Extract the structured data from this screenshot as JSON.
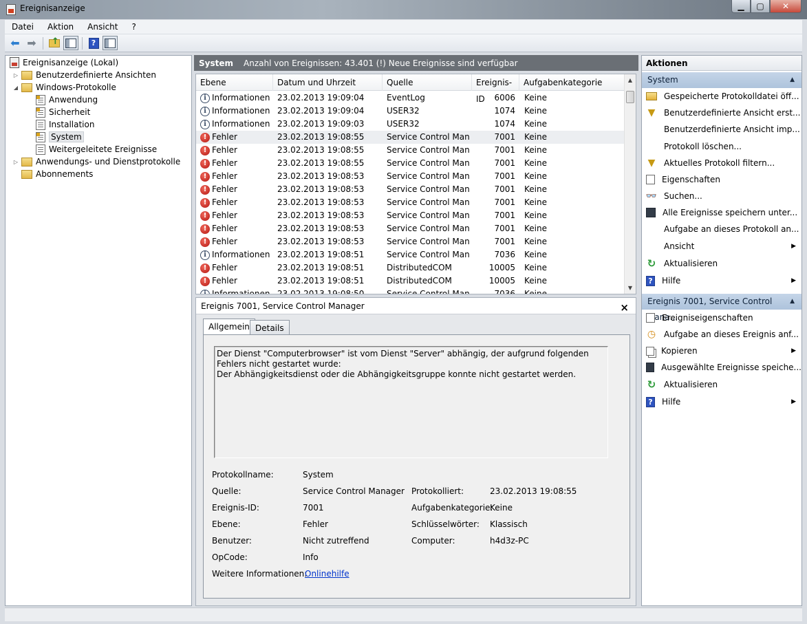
{
  "window": {
    "title": "Ereignisanzeige",
    "buttons": {
      "minimize": "▁",
      "maximize": "▢",
      "close": "✕"
    }
  },
  "menu": [
    "Datei",
    "Aktion",
    "Ansicht",
    "?"
  ],
  "tree": {
    "root": "Ereignisanzeige (Lokal)",
    "custom_views": "Benutzerdefinierte Ansichten",
    "windows_logs": "Windows-Protokolle",
    "application": "Anwendung",
    "security": "Sicherheit",
    "setup": "Installation",
    "system": "System",
    "forwarded": "Weitergeleitete Ereignisse",
    "app_service_logs": "Anwendungs- und Dienstprotokolle",
    "subscriptions": "Abonnements"
  },
  "center": {
    "title": "System",
    "info": "Anzahl von Ereignissen: 43.401 (!) Neue Ereignisse sind verfügbar"
  },
  "grid": {
    "columns": {
      "level": "Ebene",
      "date": "Datum und Uhrzeit",
      "source": "Quelle",
      "event_id": "Ereignis-ID",
      "category": "Aufgabenkategorie"
    },
    "rows": [
      {
        "type": "info",
        "level": "Informationen",
        "date": "23.02.2013 19:09:04",
        "source": "EventLog",
        "event_id": "6006",
        "category": "Keine"
      },
      {
        "type": "info",
        "level": "Informationen",
        "date": "23.02.2013 19:09:04",
        "source": "USER32",
        "event_id": "1074",
        "category": "Keine"
      },
      {
        "type": "info",
        "level": "Informationen",
        "date": "23.02.2013 19:09:03",
        "source": "USER32",
        "event_id": "1074",
        "category": "Keine"
      },
      {
        "type": "error",
        "level": "Fehler",
        "date": "23.02.2013 19:08:55",
        "source": "Service Control Man...",
        "event_id": "7001",
        "category": "Keine",
        "selected": true
      },
      {
        "type": "error",
        "level": "Fehler",
        "date": "23.02.2013 19:08:55",
        "source": "Service Control Man...",
        "event_id": "7001",
        "category": "Keine"
      },
      {
        "type": "error",
        "level": "Fehler",
        "date": "23.02.2013 19:08:55",
        "source": "Service Control Man...",
        "event_id": "7001",
        "category": "Keine"
      },
      {
        "type": "error",
        "level": "Fehler",
        "date": "23.02.2013 19:08:53",
        "source": "Service Control Man...",
        "event_id": "7001",
        "category": "Keine"
      },
      {
        "type": "error",
        "level": "Fehler",
        "date": "23.02.2013 19:08:53",
        "source": "Service Control Man...",
        "event_id": "7001",
        "category": "Keine"
      },
      {
        "type": "error",
        "level": "Fehler",
        "date": "23.02.2013 19:08:53",
        "source": "Service Control Man...",
        "event_id": "7001",
        "category": "Keine"
      },
      {
        "type": "error",
        "level": "Fehler",
        "date": "23.02.2013 19:08:53",
        "source": "Service Control Man...",
        "event_id": "7001",
        "category": "Keine"
      },
      {
        "type": "error",
        "level": "Fehler",
        "date": "23.02.2013 19:08:53",
        "source": "Service Control Man...",
        "event_id": "7001",
        "category": "Keine"
      },
      {
        "type": "error",
        "level": "Fehler",
        "date": "23.02.2013 19:08:53",
        "source": "Service Control Man...",
        "event_id": "7001",
        "category": "Keine"
      },
      {
        "type": "info",
        "level": "Informationen",
        "date": "23.02.2013 19:08:51",
        "source": "Service Control Man...",
        "event_id": "7036",
        "category": "Keine"
      },
      {
        "type": "error",
        "level": "Fehler",
        "date": "23.02.2013 19:08:51",
        "source": "DistributedCOM",
        "event_id": "10005",
        "category": "Keine"
      },
      {
        "type": "error",
        "level": "Fehler",
        "date": "23.02.2013 19:08:51",
        "source": "DistributedCOM",
        "event_id": "10005",
        "category": "Keine"
      },
      {
        "type": "info",
        "level": "Informationen",
        "date": "23.02.2013 19:08:50",
        "source": "Service Control Man...",
        "event_id": "7036",
        "category": "Keine"
      }
    ]
  },
  "detail": {
    "title": "Ereignis 7001, Service Control Manager",
    "tabs": {
      "general": "Allgemein",
      "details": "Details"
    },
    "message": "Der Dienst \"Computerbrowser\" ist vom Dienst \"Server\" abhängig, der aufgrund folgenden Fehlers nicht gestartet wurde: \nDer Abhängigkeitsdienst oder die Abhängigkeitsgruppe konnte nicht gestartet werden.",
    "labels": {
      "log_name": "Protokollname:",
      "source": "Quelle:",
      "event_id": "Ereignis-ID:",
      "level": "Ebene:",
      "user": "Benutzer:",
      "opcode": "OpCode:",
      "more_info": "Weitere Informationen:",
      "logged": "Protokolliert:",
      "task_category": "Aufgabenkategorie:",
      "keywords": "Schlüsselwörter:",
      "computer": "Computer:"
    },
    "values": {
      "log_name": "System",
      "source": "Service Control Manager",
      "event_id": "7001",
      "level": "Fehler",
      "user": "Nicht zutreffend",
      "opcode": "Info",
      "more_info_link": "Onlinehilfe",
      "logged": "23.02.2013 19:08:55",
      "task_category": "Keine",
      "keywords": "Klassisch",
      "computer": "h4d3z-PC"
    }
  },
  "actions": {
    "header": "Aktionen",
    "section1": "System",
    "items1": [
      {
        "label": "Gespeicherte Protokolldatei öff...",
        "icon": "open-folder-icon"
      },
      {
        "label": "Benutzerdefinierte Ansicht erst...",
        "icon": "filter-icon"
      },
      {
        "label": "Benutzerdefinierte Ansicht imp...",
        "icon": ""
      },
      {
        "label": "Protokoll löschen...",
        "icon": ""
      },
      {
        "label": "Aktuelles Protokoll filtern...",
        "icon": "filter-icon"
      },
      {
        "label": "Eigenschaften",
        "icon": "properties-icon"
      },
      {
        "label": "Suchen...",
        "icon": "binoculars-icon"
      },
      {
        "label": "Alle Ereignisse speichern unter...",
        "icon": "save-icon"
      },
      {
        "label": "Aufgabe an dieses Protokoll an...",
        "icon": ""
      },
      {
        "label": "Ansicht",
        "icon": "",
        "submenu": true
      },
      {
        "label": "Aktualisieren",
        "icon": "refresh-icon"
      },
      {
        "label": "Hilfe",
        "icon": "help-icon",
        "submenu": true
      }
    ],
    "section2": "Ereignis 7001, Service Control Mana...",
    "items2": [
      {
        "label": "Ereigniseigenschaften",
        "icon": "properties-icon"
      },
      {
        "label": "Aufgabe an dieses Ereignis anf...",
        "icon": "task-clock-icon"
      },
      {
        "label": "Kopieren",
        "icon": "copy-icon",
        "submenu": true
      },
      {
        "label": "Ausgewählte Ereignisse speiche...",
        "icon": "save-icon"
      },
      {
        "label": "Aktualisieren",
        "icon": "refresh-icon"
      },
      {
        "label": "Hilfe",
        "icon": "help-icon",
        "submenu": true
      }
    ]
  }
}
